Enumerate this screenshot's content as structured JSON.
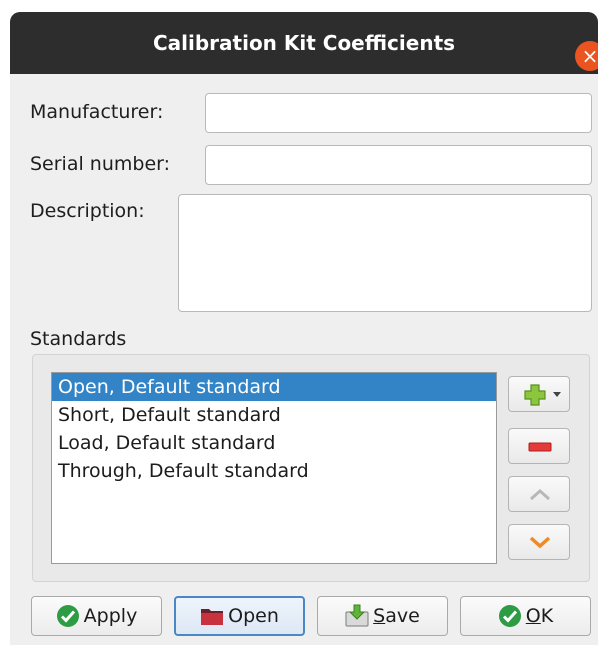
{
  "window": {
    "title": "Calibration Kit Coefficients",
    "close_icon": "close-icon"
  },
  "form": {
    "manufacturer_label": "Manufacturer:",
    "manufacturer_value": "",
    "serial_label": "Serial number:",
    "serial_value": "",
    "description_label": "Description:",
    "description_value": ""
  },
  "standards": {
    "heading": "Standards",
    "items": [
      {
        "label": "Open, Default standard",
        "selected": true
      },
      {
        "label": "Short, Default standard",
        "selected": false
      },
      {
        "label": "Load, Default standard",
        "selected": false
      },
      {
        "label": "Through, Default standard",
        "selected": false
      }
    ],
    "side_buttons": [
      "add-dropdown-icon",
      "remove-icon",
      "move-up-icon",
      "move-down-icon"
    ]
  },
  "buttons": {
    "apply": "Apply",
    "open": "Open",
    "save_mnemonic": "S",
    "save_rest": "ave",
    "ok_mnemonic": "O",
    "ok_rest": "K"
  },
  "colors": {
    "titlebar": "#2d2d2d",
    "close": "#e95420",
    "selection": "#3384c6"
  }
}
